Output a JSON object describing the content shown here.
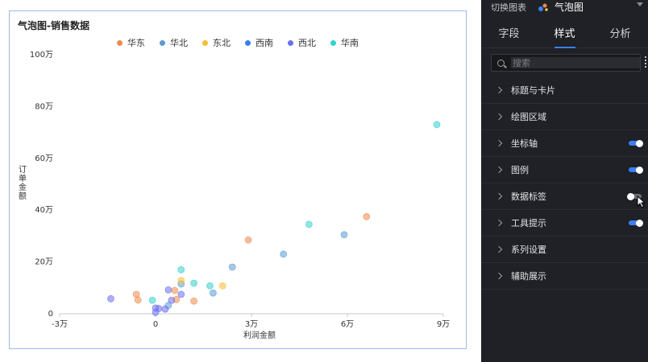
{
  "chart": {
    "title": "气泡图-销售数据"
  },
  "panel": {
    "switch_label": "切换图表",
    "chart_name": "气泡图",
    "tabs": [
      {
        "label": "字段"
      },
      {
        "label": "样式"
      },
      {
        "label": "分析"
      }
    ],
    "search_placeholder": "搜索",
    "sections": [
      {
        "label": "标题与卡片",
        "toggle": null
      },
      {
        "label": "绘图区域",
        "toggle": null
      },
      {
        "label": "坐标轴",
        "toggle": true
      },
      {
        "label": "图例",
        "toggle": true
      },
      {
        "label": "数据标签",
        "toggle": false
      },
      {
        "label": "工具提示",
        "toggle": true
      },
      {
        "label": "系列设置",
        "toggle": null
      },
      {
        "label": "辅助展示",
        "toggle": null
      }
    ],
    "accent_color": "#3d7ef5"
  },
  "chart_data": {
    "type": "scatter",
    "title": "气泡图-销售数据",
    "xlabel": "利润金额",
    "ylabel": "订单金额",
    "xlim": [
      -30000,
      90000
    ],
    "ylim": [
      0,
      1000000
    ],
    "x_ticks": [
      -30000,
      0,
      30000,
      60000,
      90000
    ],
    "x_tick_labels": [
      "-3万",
      "0",
      "3万",
      "6万",
      "9万"
    ],
    "y_ticks": [
      0,
      200000,
      400000,
      600000,
      800000,
      1000000
    ],
    "y_tick_labels": [
      "0",
      "20万",
      "40万",
      "60万",
      "80万",
      "100万"
    ],
    "grid": false,
    "legend_position": "top-center",
    "series": [
      {
        "name": "华东",
        "color": "#f08a4b",
        "points": [
          [
            -6000,
            75000
          ],
          [
            -5500,
            53000
          ],
          [
            6000,
            90000
          ],
          [
            6500,
            55000
          ],
          [
            12000,
            49000
          ],
          [
            29000,
            285000
          ],
          [
            66000,
            375000
          ]
        ]
      },
      {
        "name": "华北",
        "color": "#5b9bd5",
        "points": [
          [
            4000,
            32000
          ],
          [
            8000,
            115000
          ],
          [
            18000,
            80000
          ],
          [
            24000,
            180000
          ],
          [
            40000,
            230000
          ],
          [
            59000,
            305000
          ]
        ]
      },
      {
        "name": "东北",
        "color": "#f9bd34",
        "points": [
          [
            8000,
            128000
          ],
          [
            21000,
            108000
          ]
        ]
      },
      {
        "name": "西南",
        "color": "#3d7ef5",
        "points": []
      },
      {
        "name": "西北",
        "color": "#6b6ff0",
        "points": [
          [
            -14000,
            58000
          ],
          [
            0,
            5000
          ],
          [
            0,
            22000
          ],
          [
            1000,
            20000
          ],
          [
            3000,
            18000
          ],
          [
            4000,
            92000
          ],
          [
            5000,
            52000
          ],
          [
            8000,
            75000
          ]
        ]
      },
      {
        "name": "华南",
        "color": "#33d2cb",
        "points": [
          [
            -1000,
            52000
          ],
          [
            8000,
            170000
          ],
          [
            12000,
            118000
          ],
          [
            17000,
            108000
          ],
          [
            48000,
            345000
          ],
          [
            88000,
            730000
          ]
        ]
      }
    ]
  }
}
